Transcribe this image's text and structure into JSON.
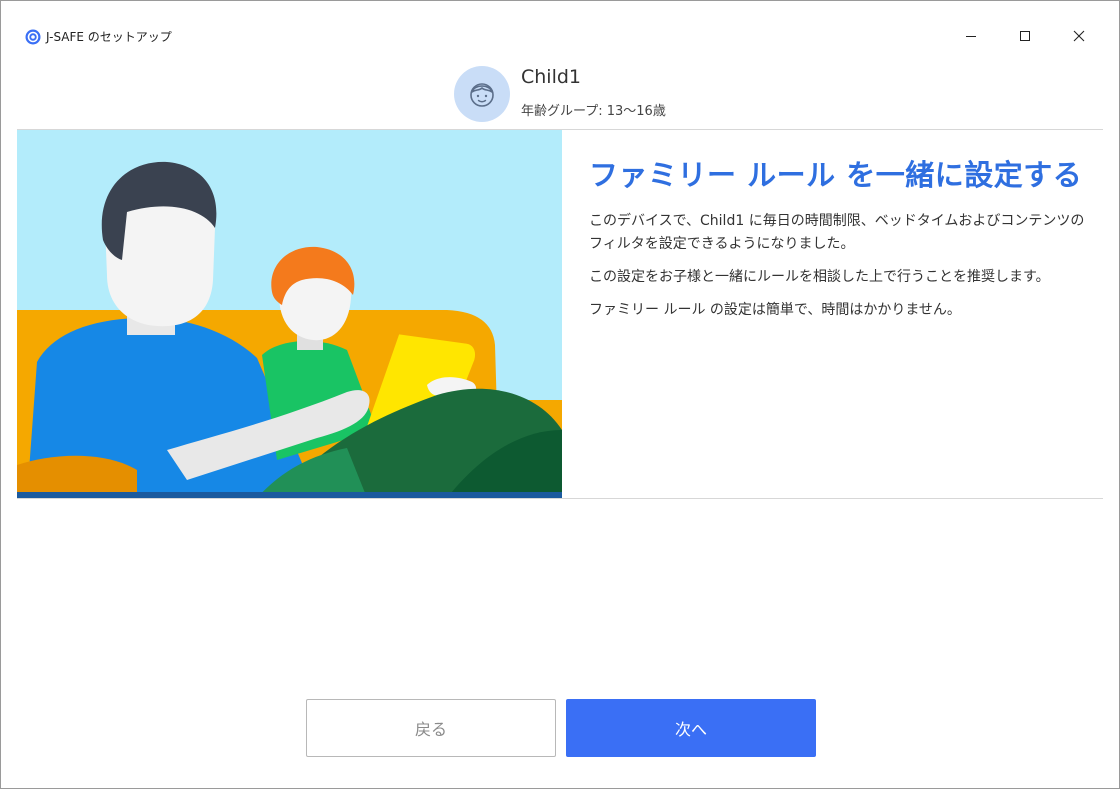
{
  "window": {
    "title": "J-SAFE のセットアップ",
    "app_icon": "j-safe-icon",
    "controls": [
      "minimize-icon",
      "maximize-icon",
      "close-icon"
    ]
  },
  "profile": {
    "avatar_icon": "child-face-icon",
    "name": "Child1",
    "age_group": "年齢グループ: 13〜16歳"
  },
  "main": {
    "illustration": "family-on-couch-illustration",
    "heading": "ファミリー ルール を一緒に設定する",
    "paragraphs": [
      "このデバイスで、Child1 に毎日の時間制限、ベッドタイムおよびコンテンツのフィルタを設定できるようになりました。",
      "この設定をお子様と一緒にルールを相談した上で行うことを推奨します。",
      "ファミリー ルール の設定は簡単で、時間はかかりません。"
    ]
  },
  "footer": {
    "back_label": "戻る",
    "next_label": "次へ"
  },
  "colors": {
    "accent": "#3a6ff5",
    "heading": "#2f6fe0",
    "avatar_bg": "#c9ddf7",
    "sky": "#b3ecfb",
    "couch": "#f5a800"
  }
}
